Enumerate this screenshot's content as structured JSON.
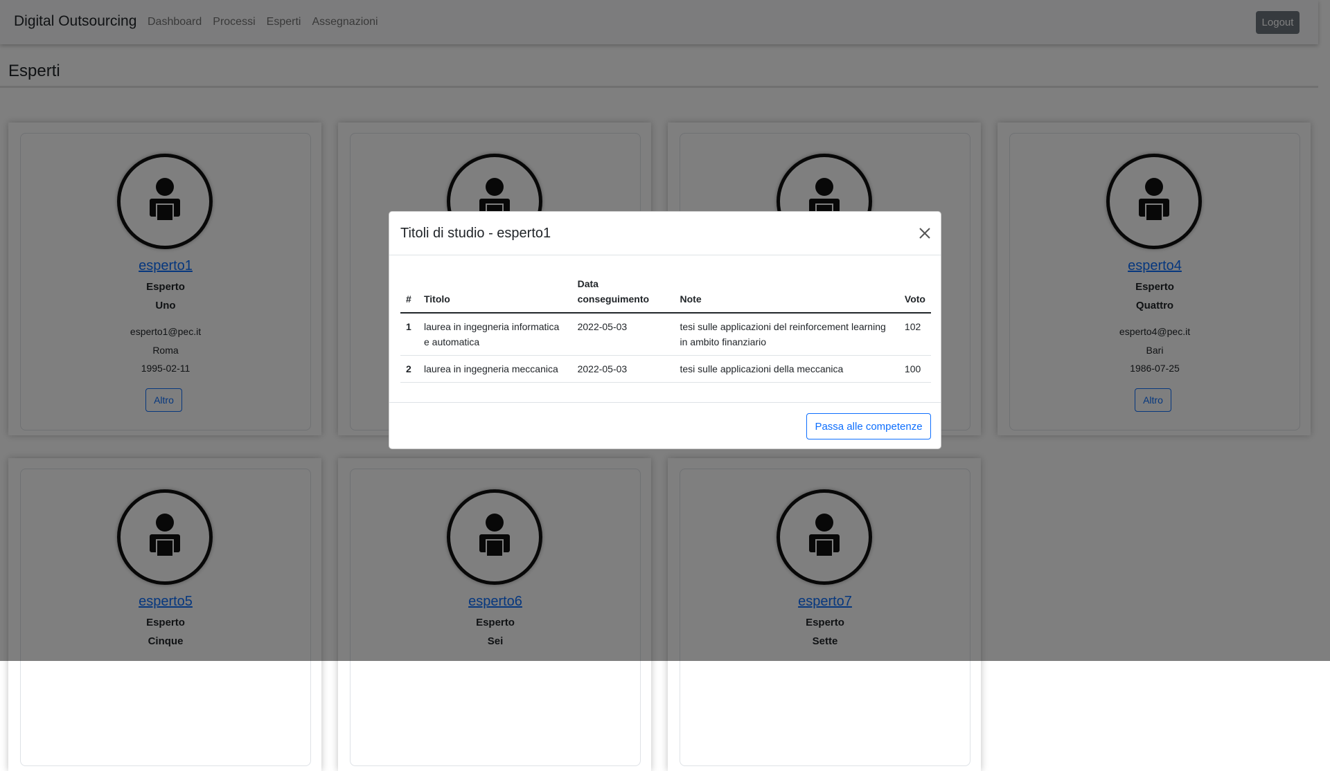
{
  "navbar": {
    "brand": "Digital Outsourcing",
    "links": [
      "Dashboard",
      "Processi",
      "Esperti",
      "Assegnazioni"
    ],
    "logout_label": "Logout"
  },
  "page": {
    "title": "Esperti"
  },
  "cards": [
    {
      "username": "esperto1",
      "role": "Esperto",
      "name": "Uno",
      "email": "esperto1@pec.it",
      "city": "Roma",
      "birth": "1995-02-11",
      "button": "Altro"
    },
    {
      "username": "",
      "role": "",
      "name": "",
      "email": "",
      "city": "",
      "birth": "",
      "button": ""
    },
    {
      "username": "",
      "role": "",
      "name": "",
      "email": "",
      "city": "",
      "birth": "",
      "button": ""
    },
    {
      "username": "esperto4",
      "role": "Esperto",
      "name": "Quattro",
      "email": "esperto4@pec.it",
      "city": "Bari",
      "birth": "1986-07-25",
      "button": "Altro"
    },
    {
      "username": "esperto5",
      "role": "Esperto",
      "name": "Cinque"
    },
    {
      "username": "esperto6",
      "role": "Esperto",
      "name": "Sei"
    },
    {
      "username": "esperto7",
      "role": "Esperto",
      "name": "Sette"
    }
  ],
  "modal": {
    "title": "Titoli di studio - esperto1",
    "columns": [
      "#",
      "Titolo",
      "Data conseguimento",
      "Note",
      "Voto"
    ],
    "rows": [
      {
        "n": "1",
        "titolo": "laurea in ingegneria informatica e automatica",
        "data": "2022-05-03",
        "note": "tesi sulle applicazioni del reinforcement learning in ambito finanziario",
        "voto": "102"
      },
      {
        "n": "2",
        "titolo": "laurea in ingegneria meccanica",
        "data": "2022-05-03",
        "note": "tesi sulle applicazioni della meccanica",
        "voto": "100"
      }
    ],
    "next_label": "Passa alle competenze"
  }
}
